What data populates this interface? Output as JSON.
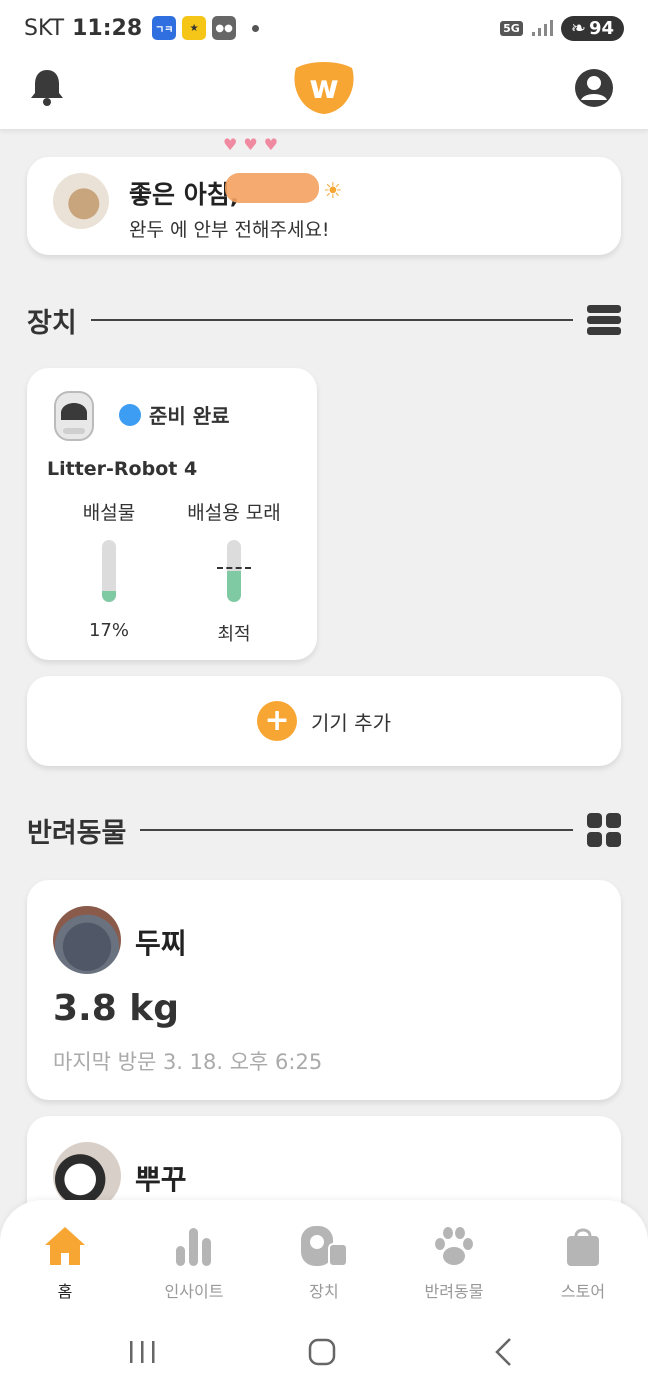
{
  "status_bar": {
    "carrier": "SKT",
    "time": "11:28",
    "network": "5G",
    "battery": "94",
    "app_icons": [
      "app-icon-blue",
      "app-icon-yellow",
      "app-icon-people"
    ]
  },
  "header": {
    "logo_letter": "w",
    "brand_color": "#f7a533"
  },
  "greeting": {
    "title": "좋은 아침,",
    "subtitle": "완두 에 안부 전해주세요!",
    "sun_icon": "☀"
  },
  "devices_section": {
    "title": "장치",
    "view_icon": "list-view-icon"
  },
  "device": {
    "status": "준비 완료",
    "status_color": "#3d9df2",
    "name": "Litter-Robot 4",
    "waste_label": "배설물",
    "waste_value": "17%",
    "waste_fraction": 0.17,
    "litter_label": "배설용 모래",
    "litter_value": "최적",
    "litter_fraction": 0.5
  },
  "add_device": {
    "label": "기기 추가",
    "plus": "+"
  },
  "pets_section": {
    "title": "반려동물",
    "view_icon": "grid-view-icon"
  },
  "pets": [
    {
      "name": "두찌",
      "weight": "3.8 kg",
      "last_visit": "마지막 방문 3. 18. 오후 6:25"
    },
    {
      "name": "뿌꾸"
    }
  ],
  "bottom_nav": {
    "items": [
      {
        "label": "홈",
        "icon": "home-icon",
        "active": true
      },
      {
        "label": "인사이트",
        "icon": "insights-icon",
        "active": false
      },
      {
        "label": "장치",
        "icon": "device-icon",
        "active": false
      },
      {
        "label": "반려동물",
        "icon": "paw-icon",
        "active": false
      },
      {
        "label": "스토어",
        "icon": "store-bag-icon",
        "active": false
      }
    ]
  },
  "colors": {
    "accent": "#f7a533",
    "gauge_fill": "#7fcaa3",
    "background": "#f0f0f0"
  }
}
